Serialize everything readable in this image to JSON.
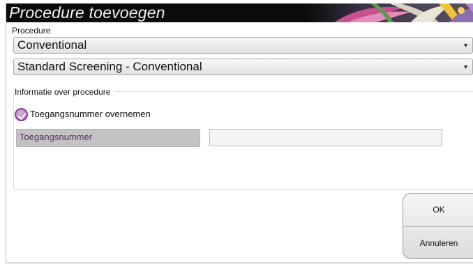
{
  "dialog": {
    "title": "Procedure toevoegen"
  },
  "procedure": {
    "section_label": "Procedure",
    "type_value": "Conventional",
    "procedure_value": "Standard Screening - Conventional"
  },
  "info": {
    "section_label": "Informatie over procedure",
    "copy_accession_label": "Toegangsnummer overnemen",
    "copy_accession_checked": true,
    "accession_label": "Toegangsnummer",
    "accession_value": ""
  },
  "buttons": {
    "ok_label": "OK",
    "cancel_label": "Annuleren"
  },
  "icons": {
    "select_caret": "chevron-down-icon",
    "check": "checkmark-icon"
  },
  "colors": {
    "title_bar": "#0b0b0b",
    "check_accent": "#8a3f97",
    "accession_label_bg": "#c3c3c3",
    "accession_label_text": "#5a2b6b"
  }
}
